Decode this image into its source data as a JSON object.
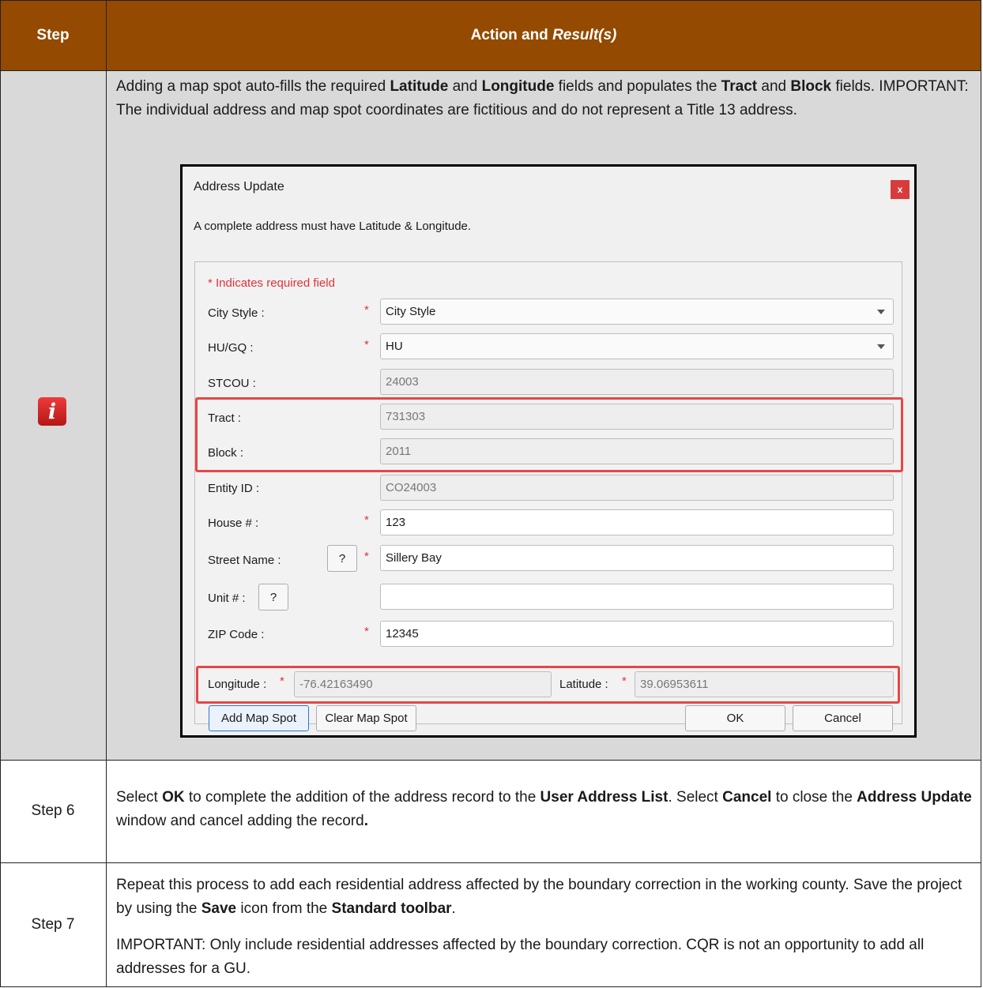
{
  "header": {
    "step_col": "Step",
    "action_col_plain": "Action and ",
    "action_col_italic": "Result(s)"
  },
  "info_row": {
    "icon": "info-icon",
    "text": {
      "p1": "Adding a map spot auto-fills the required ",
      "b1": "Latitude",
      "p2": " and ",
      "b2": "Longitude",
      "p3": " fields and populates the ",
      "b3": "Tract",
      "p4": " and ",
      "b4": "Block",
      "p5": " fields. IMPORTANT: The individual address and map spot coordinates are fictitious and do not represent a Title 13 address."
    }
  },
  "dialog": {
    "title": "Address Update",
    "close_label": "x",
    "message": "A complete address must have Latitude & Longitude.",
    "required_note": "* Indicates required field",
    "required_marker": "*",
    "fields": {
      "city_style": {
        "label": "City Style :",
        "value": "City Style"
      },
      "hu_gq": {
        "label": "HU/GQ :",
        "value": "HU"
      },
      "stcou": {
        "label": "STCOU :",
        "value": "24003"
      },
      "tract": {
        "label": "Tract :",
        "value": "731303"
      },
      "block": {
        "label": "Block :",
        "value": "2011"
      },
      "entity_id": {
        "label": "Entity ID :",
        "value": "CO24003"
      },
      "house": {
        "label": "House # :",
        "value": "123"
      },
      "street": {
        "label": "Street Name :",
        "value": "Sillery Bay",
        "help": "?"
      },
      "unit": {
        "label": "Unit # :",
        "value": "",
        "help": "?"
      },
      "zip": {
        "label": "ZIP Code :",
        "value": "12345"
      },
      "longitude": {
        "label": "Longitude :",
        "value": "-76.42163490"
      },
      "latitude": {
        "label": "Latitude :",
        "value": "39.06953611"
      }
    },
    "buttons": {
      "add_map_spot": "Add Map Spot",
      "clear_map_spot": "Clear Map Spot",
      "ok": "OK",
      "cancel": "Cancel"
    }
  },
  "step6": {
    "label": "Step 6",
    "p1": "Select ",
    "b1": "OK",
    "p2": " to complete the addition of the address record to the ",
    "b2": "User Address List",
    "p3": ". Select ",
    "b3": "Cancel",
    "p4": " to close the ",
    "b4": "Address Update",
    "p5": " window and cancel adding the record",
    "b5": "."
  },
  "step7": {
    "label": "Step 7",
    "p1": "Repeat this process to add each residential address affected by the boundary correction in the working county. Save the project by using the ",
    "b1": "Save",
    "p2": " icon from the ",
    "b2": "Standard toolbar",
    "p3": ".",
    "important": "IMPORTANT: Only include residential addresses affected by the boundary correction. CQR is not an opportunity to add all addresses for a GU."
  },
  "colors": {
    "header_bg": "#944a00",
    "info_row_bg": "#d9d9d9",
    "highlight": "#e94545",
    "required": "#e2313a"
  }
}
